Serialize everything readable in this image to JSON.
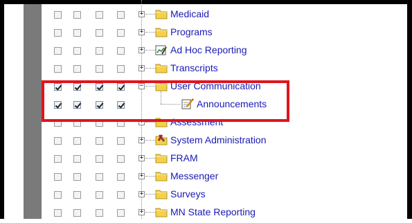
{
  "tree": {
    "items": [
      {
        "label": "Medicaid",
        "icon": "folder-icon",
        "checks": [
          false,
          false,
          false,
          false
        ],
        "expander": "+"
      },
      {
        "label": "Programs",
        "icon": "folder-icon",
        "checks": [
          false,
          false,
          false,
          false
        ],
        "expander": "+"
      },
      {
        "label": "Ad Hoc Reporting",
        "icon": "report-icon",
        "checks": [
          false,
          false,
          false,
          false
        ],
        "expander": "+"
      },
      {
        "label": "Transcripts",
        "icon": "folder-icon",
        "checks": [
          false,
          false,
          false,
          false
        ],
        "expander": "+"
      },
      {
        "label": "User Communication",
        "icon": "folder-icon",
        "checks": [
          true,
          true,
          true,
          true
        ],
        "expander": "−"
      },
      {
        "label": "Announcements",
        "icon": "note-edit-icon",
        "checks": [
          true,
          true,
          true,
          true
        ],
        "expander": ""
      },
      {
        "label": "Assessment",
        "icon": "folder-icon",
        "checks": [
          false,
          false,
          false,
          false
        ],
        "expander": "+"
      },
      {
        "label": "System Administration",
        "icon": "admin-tools-icon",
        "checks": [
          false,
          false,
          false,
          false
        ],
        "expander": "+"
      },
      {
        "label": "FRAM",
        "icon": "folder-icon",
        "checks": [
          false,
          false,
          false,
          false
        ],
        "expander": "+"
      },
      {
        "label": "Messenger",
        "icon": "folder-icon",
        "checks": [
          false,
          false,
          false,
          false
        ],
        "expander": "+"
      },
      {
        "label": "Surveys",
        "icon": "folder-icon",
        "checks": [
          false,
          false,
          false,
          false
        ],
        "expander": "+"
      },
      {
        "label": "MN State Reporting",
        "icon": "folder-icon",
        "checks": [
          false,
          false,
          false,
          false
        ],
        "expander": "+"
      }
    ]
  },
  "colors": {
    "link": "#1a1ab4",
    "highlight": "#e0141e",
    "gutter": "#7a7a7a",
    "folder": "#f5d04a"
  }
}
